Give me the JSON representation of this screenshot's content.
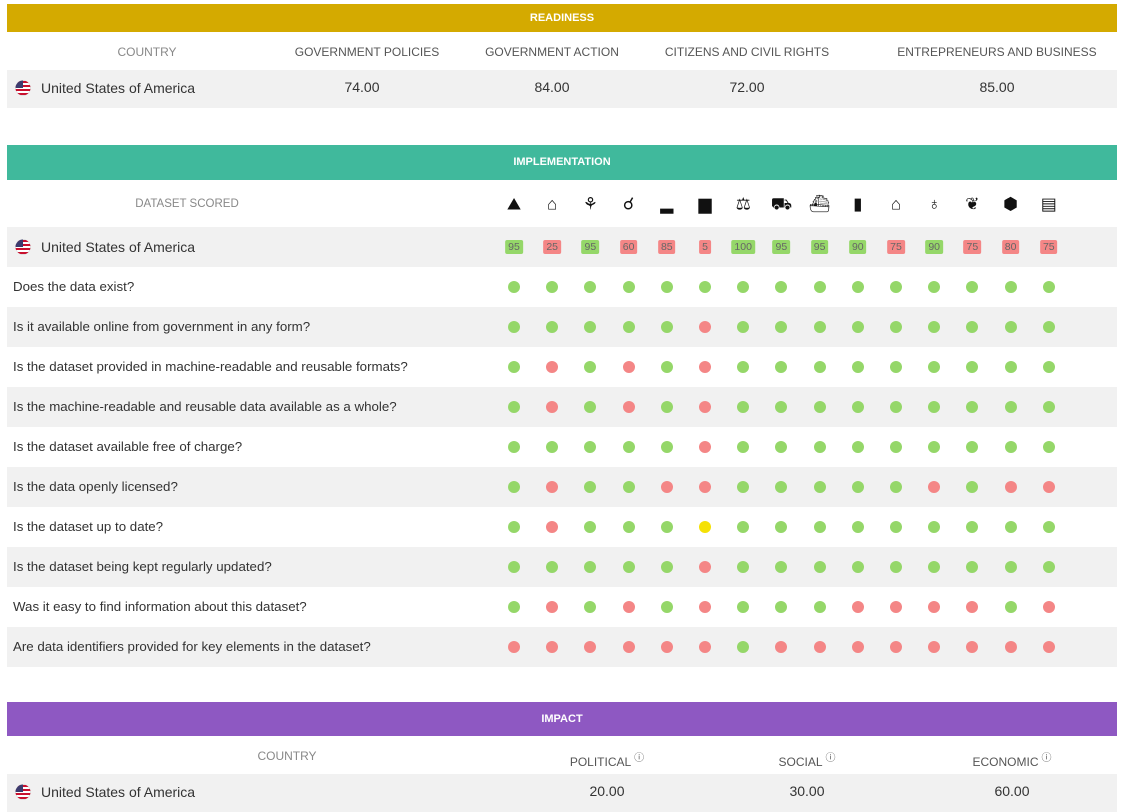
{
  "colors": {
    "readiness": "#d4aa00",
    "implementation": "#40b99c",
    "impact": "#8e58c2",
    "green": "#95d769",
    "red": "#f48686",
    "yellow": "#f5e106",
    "row_gray": "#f1f1f1"
  },
  "readiness": {
    "title": "READINESS",
    "headers": [
      "COUNTRY",
      "GOVERNMENT POLICIES",
      "GOVERNMENT ACTION",
      "CITIZENS AND CIVIL RIGHTS",
      "ENTREPRENEURS AND BUSINESS"
    ],
    "country": "United States of America",
    "values": [
      "74.00",
      "84.00",
      "72.00",
      "85.00"
    ]
  },
  "implementation": {
    "title": "IMPLEMENTATION",
    "dataset_label": "DATASET SCORED",
    "country": "United States of America",
    "icons": [
      "map-icon",
      "gavel-icon",
      "chart-icon",
      "fingerprint-icon",
      "bars-icon",
      "building-icon",
      "scales-icon",
      "train-icon",
      "ship-icon",
      "bag-icon",
      "house-icon",
      "globe-icon",
      "leaf-icon",
      "box-icon",
      "document-icon"
    ],
    "icon_glyphs": [
      "⛰",
      "⌂",
      "⚘",
      "☌",
      "▂",
      "▆",
      "⚖",
      "⛟",
      "⛴",
      "▮",
      "⌂",
      "♁",
      "❦",
      "⬢",
      "▤"
    ],
    "scores": [
      "95",
      "25",
      "95",
      "60",
      "85",
      "5",
      "100",
      "95",
      "95",
      "90",
      "75",
      "90",
      "75",
      "80",
      "75"
    ],
    "score_status": [
      "g",
      "r",
      "g",
      "r",
      "r",
      "r",
      "g",
      "g",
      "g",
      "g",
      "r",
      "g",
      "r",
      "r",
      "r"
    ],
    "questions": [
      {
        "text": "Does the data exist?",
        "dots": "ggggggggggggggg"
      },
      {
        "text": "Is it available online from government in any form?",
        "dots": "gggggrggggggggg"
      },
      {
        "text": "Is the dataset provided in machine-readable and reusable formats?",
        "dots": "grgrgrggggggggg"
      },
      {
        "text": "Is the machine-readable and reusable data available as a whole?",
        "dots": "grgrgrggggggggg"
      },
      {
        "text": "Is the dataset available free of charge?",
        "dots": "gggggrggggggggg"
      },
      {
        "text": "Is the data openly licensed?",
        "dots": "grggrrgggggrgrrr"
      },
      {
        "text": "Is the dataset up to date?",
        "dots": "grgggyggggggggg"
      },
      {
        "text": "Is the dataset being kept regularly updated?",
        "dots": "gggggrggggggggg"
      },
      {
        "text": "Was it easy to find information about this dataset?",
        "dots": "grgrgrgggrrrrgr"
      },
      {
        "text": "Are data identifiers provided for key elements in the dataset?",
        "dots": "rrrrrrgrrrrrrrr"
      }
    ]
  },
  "impact": {
    "title": "IMPACT",
    "headers": [
      "COUNTRY",
      "POLITICAL",
      "SOCIAL",
      "ECONOMIC"
    ],
    "info_glyph": "ⓘ",
    "country": "United States of America",
    "values": [
      "20.00",
      "30.00",
      "60.00"
    ]
  }
}
